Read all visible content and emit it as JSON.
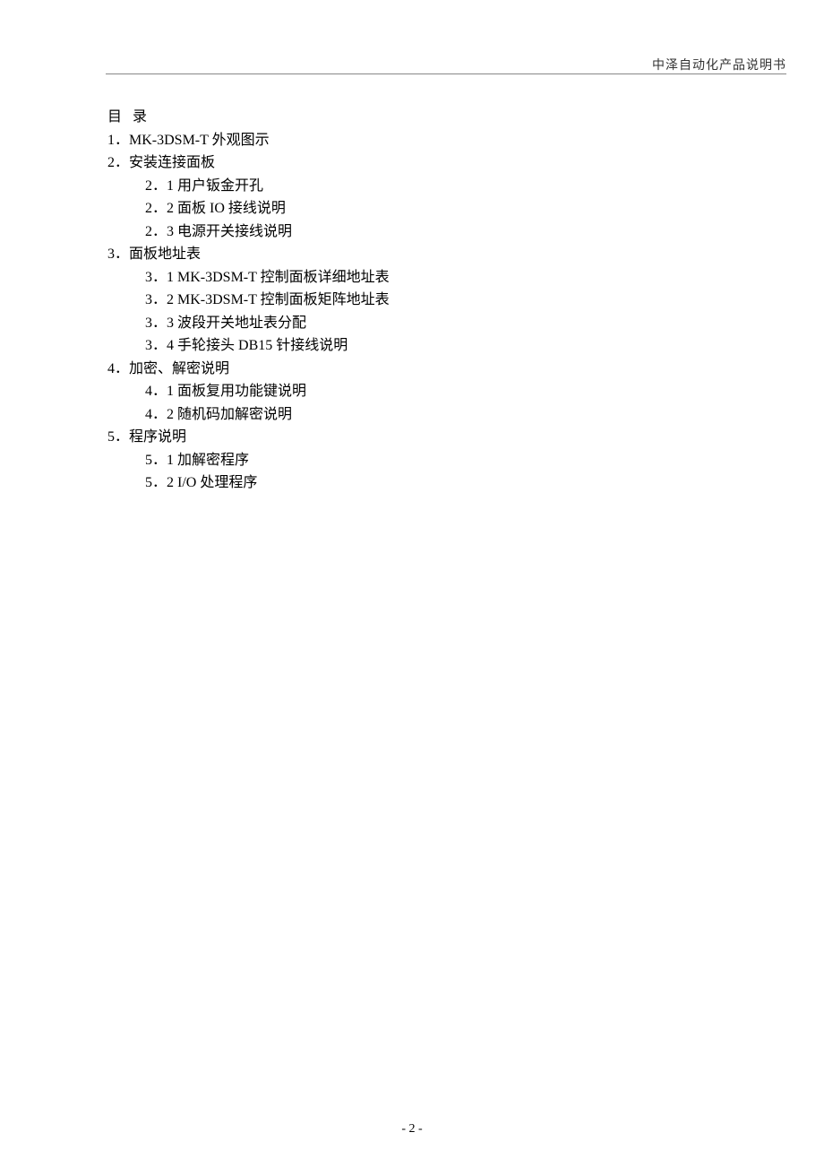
{
  "header": "中泽自动化产品说明书",
  "toc_title": "目 录",
  "toc": [
    {
      "num": "1．",
      "text": "MK-3DSM-T 外观图示",
      "level": 1
    },
    {
      "num": "2．",
      "text": "安装连接面板",
      "level": 1
    },
    {
      "num": "2．1",
      "text": "  用户钣金开孔",
      "level": 2
    },
    {
      "num": "2．2",
      "text": "  面板 IO 接线说明",
      "level": 2
    },
    {
      "num": "2．3",
      "text": "  电源开关接线说明",
      "level": 2
    },
    {
      "num": "3．",
      "text": "面板地址表",
      "level": 1
    },
    {
      "num": "3．1",
      "text": "  MK-3DSM-T 控制面板详细地址表",
      "level": 2
    },
    {
      "num": "3．2",
      "text": "  MK-3DSM-T 控制面板矩阵地址表",
      "level": 2
    },
    {
      "num": "3．3",
      "text": "  波段开关地址表分配",
      "level": 2
    },
    {
      "num": "3．4",
      "text": "  手轮接头 DB15 针接线说明",
      "level": 2
    },
    {
      "num": "4．",
      "text": "加密、解密说明",
      "level": 1
    },
    {
      "num": "4．1",
      "text": "  面板复用功能键说明",
      "level": 2
    },
    {
      "num": "4．2",
      "text": "  随机码加解密说明",
      "level": 2
    },
    {
      "num": "5．",
      "text": "程序说明",
      "level": 1
    },
    {
      "num": "5．1",
      "text": "  加解密程序",
      "level": 2
    },
    {
      "num": "5．2",
      "text": "  I/O 处理程序",
      "level": 2
    }
  ],
  "page_number": "- 2 -"
}
